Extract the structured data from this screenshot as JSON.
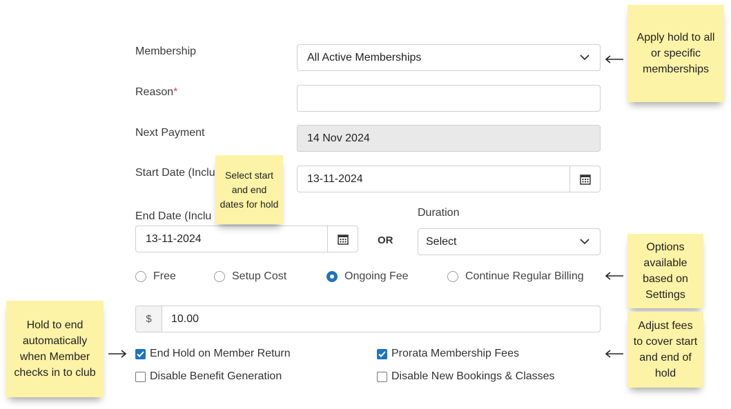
{
  "form": {
    "membership": {
      "label": "Membership",
      "value": "All Active Memberships"
    },
    "reason": {
      "label": "Reason",
      "required_marker": "*",
      "value": ""
    },
    "next_payment": {
      "label": "Next Payment",
      "value": "14 Nov 2024"
    },
    "start_date": {
      "label": "Start Date (Inclu",
      "value": "13-11-2024"
    },
    "end_date": {
      "label": "End Date (Inclu",
      "value": "13-11-2024"
    },
    "or_label": "OR",
    "duration": {
      "label": "Duration",
      "value": "Select"
    },
    "fee_options": [
      {
        "label": "Free",
        "selected": false
      },
      {
        "label": "Setup Cost",
        "selected": false
      },
      {
        "label": "Ongoing Fee",
        "selected": true
      },
      {
        "label": "Continue Regular Billing",
        "selected": false
      }
    ],
    "fee": {
      "currency": "$",
      "value": "10.00"
    },
    "checkboxes": [
      {
        "label": "End Hold on Member Return",
        "checked": true
      },
      {
        "label": "Prorata Membership Fees",
        "checked": true
      },
      {
        "label": "Disable Benefit Generation",
        "checked": false
      },
      {
        "label": "Disable New Bookings & Classes",
        "checked": false
      }
    ]
  },
  "notes": {
    "apply_hold": "Apply hold to all or specific memberships",
    "select_dates": "Select start and end dates for hold",
    "options": "Options available based on Settings",
    "hold_end": "Hold to end automatically when Member checks in to club",
    "adjust_fees": "Adjust fees to cover start and end of hold"
  },
  "colors": {
    "accent": "#1e73be",
    "note_bg": "#fcf3a6",
    "required": "#e0474f"
  },
  "icons": [
    "chevron-down-icon",
    "calendar-icon",
    "arrow-left-icon",
    "arrow-right-icon"
  ]
}
